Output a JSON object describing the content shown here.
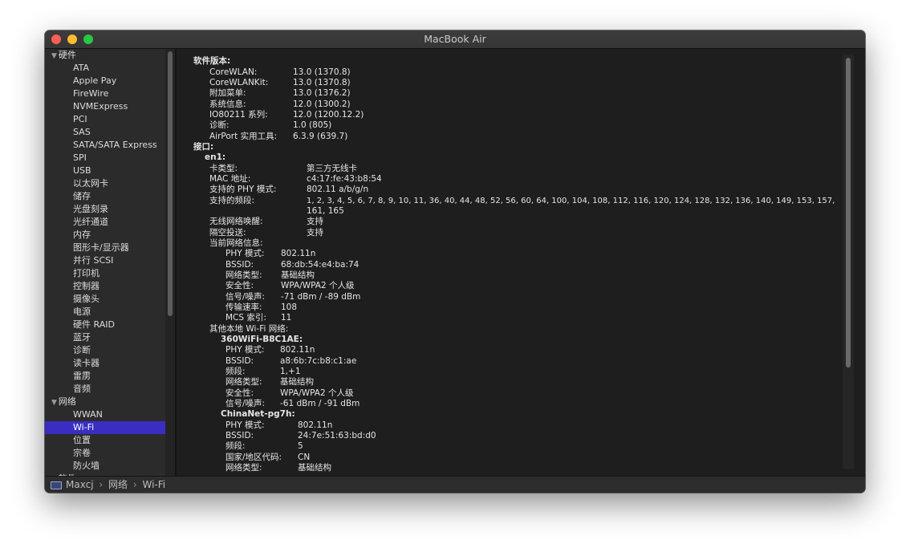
{
  "window": {
    "title": "MacBook Air"
  },
  "sidebar": {
    "hardware": {
      "label": "硬件",
      "items": [
        "ATA",
        "Apple Pay",
        "FireWire",
        "NVMExpress",
        "PCI",
        "SAS",
        "SATA/SATA Express",
        "SPI",
        "USB",
        "以太网卡",
        "储存",
        "光盘刻录",
        "光纤通道",
        "内存",
        "图形卡/显示器",
        "并行 SCSI",
        "打印机",
        "控制器",
        "摄像头",
        "电源",
        "硬件 RAID",
        "蓝牙",
        "诊断",
        "读卡器",
        "雷雳",
        "音频"
      ]
    },
    "network": {
      "label": "网络",
      "items": [
        "WWAN",
        "Wi-Fi",
        "位置",
        "宗卷",
        "防火墙"
      ],
      "selected": "Wi-Fi"
    },
    "software": {
      "label": "软件"
    }
  },
  "content": {
    "software_versions": {
      "heading": "软件版本:",
      "rows": [
        {
          "k": "CoreWLAN:",
          "v": "13.0 (1370.8)"
        },
        {
          "k": "CoreWLANKit:",
          "v": "13.0 (1370.8)"
        },
        {
          "k": "附加菜单:",
          "v": "13.0 (1376.2)"
        },
        {
          "k": "系统信息:",
          "v": "12.0 (1300.2)"
        },
        {
          "k": "IO80211 系列:",
          "v": "12.0 (1200.12.2)"
        },
        {
          "k": "诊断:",
          "v": "1.0 (805)"
        },
        {
          "k": "AirPort 实用工具:",
          "v": "6.3.9 (639.7)"
        }
      ]
    },
    "interfaces": {
      "heading": "接口:",
      "name": "en1:",
      "rows": [
        {
          "k": "卡类型:",
          "v": "第三方无线卡"
        },
        {
          "k": "MAC 地址:",
          "v": "c4:17:fe:43:b8:54"
        },
        {
          "k": "支持的 PHY 模式:",
          "v": "802.11 a/b/g/n"
        },
        {
          "k": "支持的频段:",
          "v": "1, 2, 3, 4, 5, 6, 7, 8, 9, 10, 11, 36, 40, 44, 48, 52, 56, 60, 64, 100, 104, 108, 112, 116, 120, 124, 128, 132, 136, 140, 149, 153, 157,",
          "v2": "161, 165"
        },
        {
          "k": "无线网络唤醒:",
          "v": "支持"
        },
        {
          "k": "隔空投送:",
          "v": "支持"
        }
      ],
      "current_heading": "当前网络信息:",
      "current": [
        {
          "k": "PHY 模式:",
          "v": "802.11n"
        },
        {
          "k": "BSSID:",
          "v": "68:db:54:e4:ba:74"
        },
        {
          "k": "网络类型:",
          "v": "基础结构"
        },
        {
          "k": "安全性:",
          "v": "WPA/WPA2 个人级"
        },
        {
          "k": "信号/噪声:",
          "v": "-71 dBm / -89 dBm"
        },
        {
          "k": "传输速率:",
          "v": "108"
        },
        {
          "k": "MCS 索引:",
          "v": "11"
        }
      ],
      "others_heading": "其他本地 Wi-Fi 网络:",
      "net1": {
        "name": "360WiFi-B8C1AE:",
        "rows": [
          {
            "k": "PHY 模式:",
            "v": "802.11n"
          },
          {
            "k": "BSSID:",
            "v": "a8:6b:7c:b8:c1:ae"
          },
          {
            "k": "频段:",
            "v": "1,+1"
          },
          {
            "k": "网络类型:",
            "v": "基础结构"
          },
          {
            "k": "安全性:",
            "v": "WPA/WPA2 个人级"
          },
          {
            "k": "信号/噪声:",
            "v": "-61 dBm / -91 dBm"
          }
        ]
      },
      "net2": {
        "name": "ChinaNet-pg7h:",
        "rows": [
          {
            "k": "PHY 模式:",
            "v": "802.11n"
          },
          {
            "k": "BSSID:",
            "v": "24:7e:51:63:bd:d0"
          },
          {
            "k": "频段:",
            "v": "5"
          },
          {
            "k": "国家/地区代码:",
            "v": "CN"
          },
          {
            "k": "网络类型:",
            "v": "基础结构"
          }
        ]
      }
    }
  },
  "statusbar": {
    "crumbs": [
      "Maxcj",
      "网络",
      "Wi-Fi"
    ],
    "separator": "›"
  },
  "colors": {
    "selection": "#3a2ec2",
    "close": "#fe5f57",
    "minimize": "#febc2e",
    "zoom": "#28c840"
  }
}
